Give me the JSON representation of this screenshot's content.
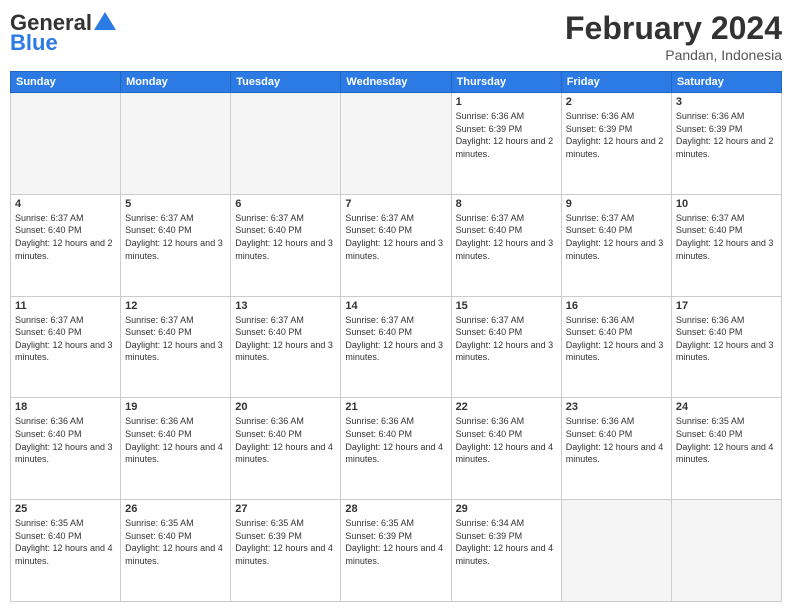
{
  "header": {
    "logo_general": "General",
    "logo_blue": "Blue",
    "title": "February 2024",
    "subtitle": "Pandan, Indonesia"
  },
  "columns": [
    "Sunday",
    "Monday",
    "Tuesday",
    "Wednesday",
    "Thursday",
    "Friday",
    "Saturday"
  ],
  "rows": [
    [
      {
        "day": "",
        "empty": true
      },
      {
        "day": "",
        "empty": true
      },
      {
        "day": "",
        "empty": true
      },
      {
        "day": "",
        "empty": true
      },
      {
        "day": "1",
        "sunrise": "Sunrise: 6:36 AM",
        "sunset": "Sunset: 6:39 PM",
        "daylight": "Daylight: 12 hours and 2 minutes."
      },
      {
        "day": "2",
        "sunrise": "Sunrise: 6:36 AM",
        "sunset": "Sunset: 6:39 PM",
        "daylight": "Daylight: 12 hours and 2 minutes."
      },
      {
        "day": "3",
        "sunrise": "Sunrise: 6:36 AM",
        "sunset": "Sunset: 6:39 PM",
        "daylight": "Daylight: 12 hours and 2 minutes."
      }
    ],
    [
      {
        "day": "4",
        "sunrise": "Sunrise: 6:37 AM",
        "sunset": "Sunset: 6:40 PM",
        "daylight": "Daylight: 12 hours and 2 minutes."
      },
      {
        "day": "5",
        "sunrise": "Sunrise: 6:37 AM",
        "sunset": "Sunset: 6:40 PM",
        "daylight": "Daylight: 12 hours and 3 minutes."
      },
      {
        "day": "6",
        "sunrise": "Sunrise: 6:37 AM",
        "sunset": "Sunset: 6:40 PM",
        "daylight": "Daylight: 12 hours and 3 minutes."
      },
      {
        "day": "7",
        "sunrise": "Sunrise: 6:37 AM",
        "sunset": "Sunset: 6:40 PM",
        "daylight": "Daylight: 12 hours and 3 minutes."
      },
      {
        "day": "8",
        "sunrise": "Sunrise: 6:37 AM",
        "sunset": "Sunset: 6:40 PM",
        "daylight": "Daylight: 12 hours and 3 minutes."
      },
      {
        "day": "9",
        "sunrise": "Sunrise: 6:37 AM",
        "sunset": "Sunset: 6:40 PM",
        "daylight": "Daylight: 12 hours and 3 minutes."
      },
      {
        "day": "10",
        "sunrise": "Sunrise: 6:37 AM",
        "sunset": "Sunset: 6:40 PM",
        "daylight": "Daylight: 12 hours and 3 minutes."
      }
    ],
    [
      {
        "day": "11",
        "sunrise": "Sunrise: 6:37 AM",
        "sunset": "Sunset: 6:40 PM",
        "daylight": "Daylight: 12 hours and 3 minutes."
      },
      {
        "day": "12",
        "sunrise": "Sunrise: 6:37 AM",
        "sunset": "Sunset: 6:40 PM",
        "daylight": "Daylight: 12 hours and 3 minutes."
      },
      {
        "day": "13",
        "sunrise": "Sunrise: 6:37 AM",
        "sunset": "Sunset: 6:40 PM",
        "daylight": "Daylight: 12 hours and 3 minutes."
      },
      {
        "day": "14",
        "sunrise": "Sunrise: 6:37 AM",
        "sunset": "Sunset: 6:40 PM",
        "daylight": "Daylight: 12 hours and 3 minutes."
      },
      {
        "day": "15",
        "sunrise": "Sunrise: 6:37 AM",
        "sunset": "Sunset: 6:40 PM",
        "daylight": "Daylight: 12 hours and 3 minutes."
      },
      {
        "day": "16",
        "sunrise": "Sunrise: 6:36 AM",
        "sunset": "Sunset: 6:40 PM",
        "daylight": "Daylight: 12 hours and 3 minutes."
      },
      {
        "day": "17",
        "sunrise": "Sunrise: 6:36 AM",
        "sunset": "Sunset: 6:40 PM",
        "daylight": "Daylight: 12 hours and 3 minutes."
      }
    ],
    [
      {
        "day": "18",
        "sunrise": "Sunrise: 6:36 AM",
        "sunset": "Sunset: 6:40 PM",
        "daylight": "Daylight: 12 hours and 3 minutes."
      },
      {
        "day": "19",
        "sunrise": "Sunrise: 6:36 AM",
        "sunset": "Sunset: 6:40 PM",
        "daylight": "Daylight: 12 hours and 4 minutes."
      },
      {
        "day": "20",
        "sunrise": "Sunrise: 6:36 AM",
        "sunset": "Sunset: 6:40 PM",
        "daylight": "Daylight: 12 hours and 4 minutes."
      },
      {
        "day": "21",
        "sunrise": "Sunrise: 6:36 AM",
        "sunset": "Sunset: 6:40 PM",
        "daylight": "Daylight: 12 hours and 4 minutes."
      },
      {
        "day": "22",
        "sunrise": "Sunrise: 6:36 AM",
        "sunset": "Sunset: 6:40 PM",
        "daylight": "Daylight: 12 hours and 4 minutes."
      },
      {
        "day": "23",
        "sunrise": "Sunrise: 6:36 AM",
        "sunset": "Sunset: 6:40 PM",
        "daylight": "Daylight: 12 hours and 4 minutes."
      },
      {
        "day": "24",
        "sunrise": "Sunrise: 6:35 AM",
        "sunset": "Sunset: 6:40 PM",
        "daylight": "Daylight: 12 hours and 4 minutes."
      }
    ],
    [
      {
        "day": "25",
        "sunrise": "Sunrise: 6:35 AM",
        "sunset": "Sunset: 6:40 PM",
        "daylight": "Daylight: 12 hours and 4 minutes."
      },
      {
        "day": "26",
        "sunrise": "Sunrise: 6:35 AM",
        "sunset": "Sunset: 6:40 PM",
        "daylight": "Daylight: 12 hours and 4 minutes."
      },
      {
        "day": "27",
        "sunrise": "Sunrise: 6:35 AM",
        "sunset": "Sunset: 6:39 PM",
        "daylight": "Daylight: 12 hours and 4 minutes."
      },
      {
        "day": "28",
        "sunrise": "Sunrise: 6:35 AM",
        "sunset": "Sunset: 6:39 PM",
        "daylight": "Daylight: 12 hours and 4 minutes."
      },
      {
        "day": "29",
        "sunrise": "Sunrise: 6:34 AM",
        "sunset": "Sunset: 6:39 PM",
        "daylight": "Daylight: 12 hours and 4 minutes."
      },
      {
        "day": "",
        "empty": true
      },
      {
        "day": "",
        "empty": true
      }
    ]
  ]
}
